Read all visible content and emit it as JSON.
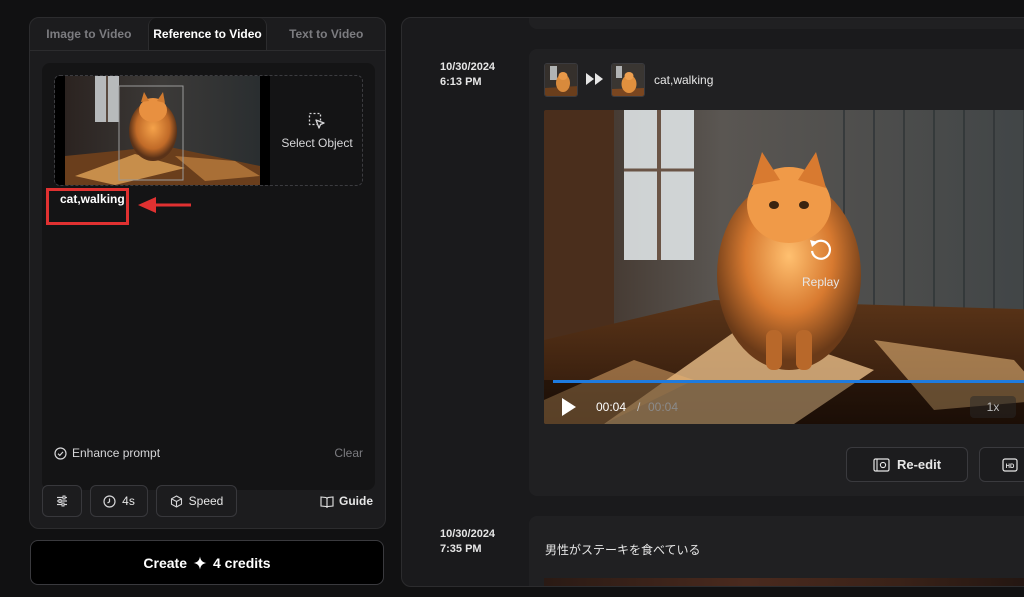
{
  "tabs": [
    {
      "label": "Image to Video",
      "active": false
    },
    {
      "label": "Reference to Video",
      "active": true
    },
    {
      "label": "Text to Video",
      "active": false
    }
  ],
  "reference": {
    "select_object_label": "Select Object",
    "select_object_icon": "select-object-icon",
    "prompt": "cat,walking"
  },
  "prompt_card": {
    "enhance_label": "Enhance prompt",
    "clear_label": "Clear"
  },
  "toolbar": {
    "settings_icon": "sliders-icon",
    "duration_label": "4s",
    "speed_label": "Speed",
    "guide_label": "Guide"
  },
  "create": {
    "label": "Create",
    "credits_label": "4 credits",
    "icon": "sparkle-icon"
  },
  "history": [
    {
      "date": "10/30/2024",
      "time": "6:13 PM",
      "prompt": "cat,walking",
      "video": {
        "replay_label": "Replay",
        "current_time": "00:04",
        "separator": "/",
        "duration": "00:04",
        "playback_rate": "1x",
        "progress": 1.0
      },
      "actions": {
        "reedit_label": "Re-edit",
        "hd_icon": "hd-icon"
      }
    },
    {
      "date": "10/30/2024",
      "time": "7:35 PM",
      "prompt": "男性がステーキを食べている"
    }
  ],
  "colors": {
    "accent_progress": "#1e7be0",
    "annotation_red": "#e03131",
    "panel_bg": "#1c1c1e",
    "page_bg": "#111112"
  }
}
